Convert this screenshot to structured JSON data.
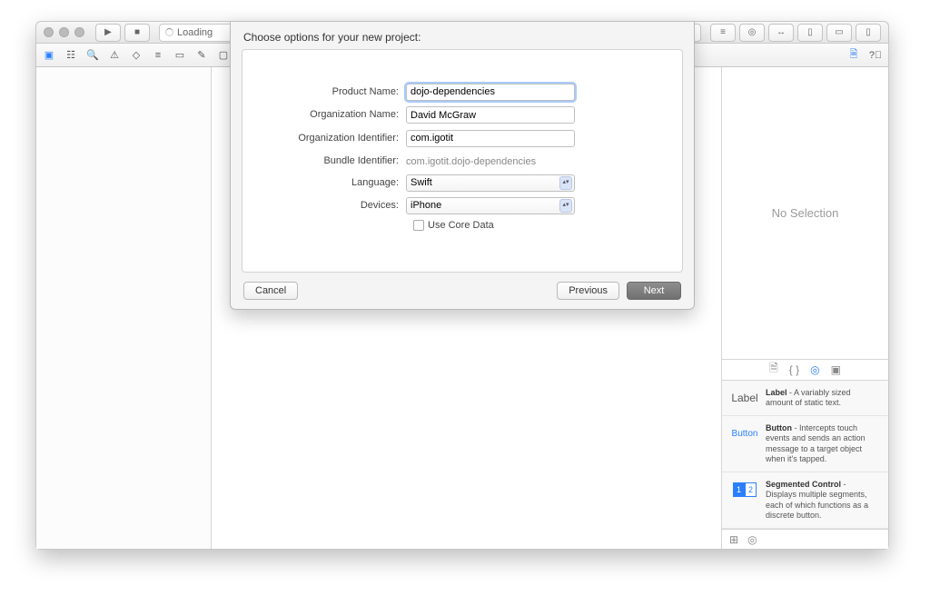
{
  "titlebar": {
    "address_text": "Loading"
  },
  "inspector": {
    "no_selection": "No Selection",
    "library": [
      {
        "name": "Label",
        "desc": " - A variably sized amount of static text."
      },
      {
        "name": "Button",
        "desc": " - Intercepts touch events and sends an action message to a target object when it's tapped."
      },
      {
        "name": "Segmented Control",
        "desc": " - Displays multiple segments, each of which functions as a discrete button."
      }
    ]
  },
  "sheet": {
    "title": "Choose options for your new project:",
    "labels": {
      "product_name": "Product Name:",
      "org_name": "Organization Name:",
      "org_id": "Organization Identifier:",
      "bundle_id": "Bundle Identifier:",
      "language": "Language:",
      "devices": "Devices:",
      "core_data": "Use Core Data"
    },
    "values": {
      "product_name": "dojo-dependencies",
      "org_name": "David McGraw",
      "org_id": "com.igotit",
      "bundle_id": "com.igotit.dojo-dependencies",
      "language": "Swift",
      "devices": "iPhone"
    },
    "buttons": {
      "cancel": "Cancel",
      "previous": "Previous",
      "next": "Next"
    }
  }
}
